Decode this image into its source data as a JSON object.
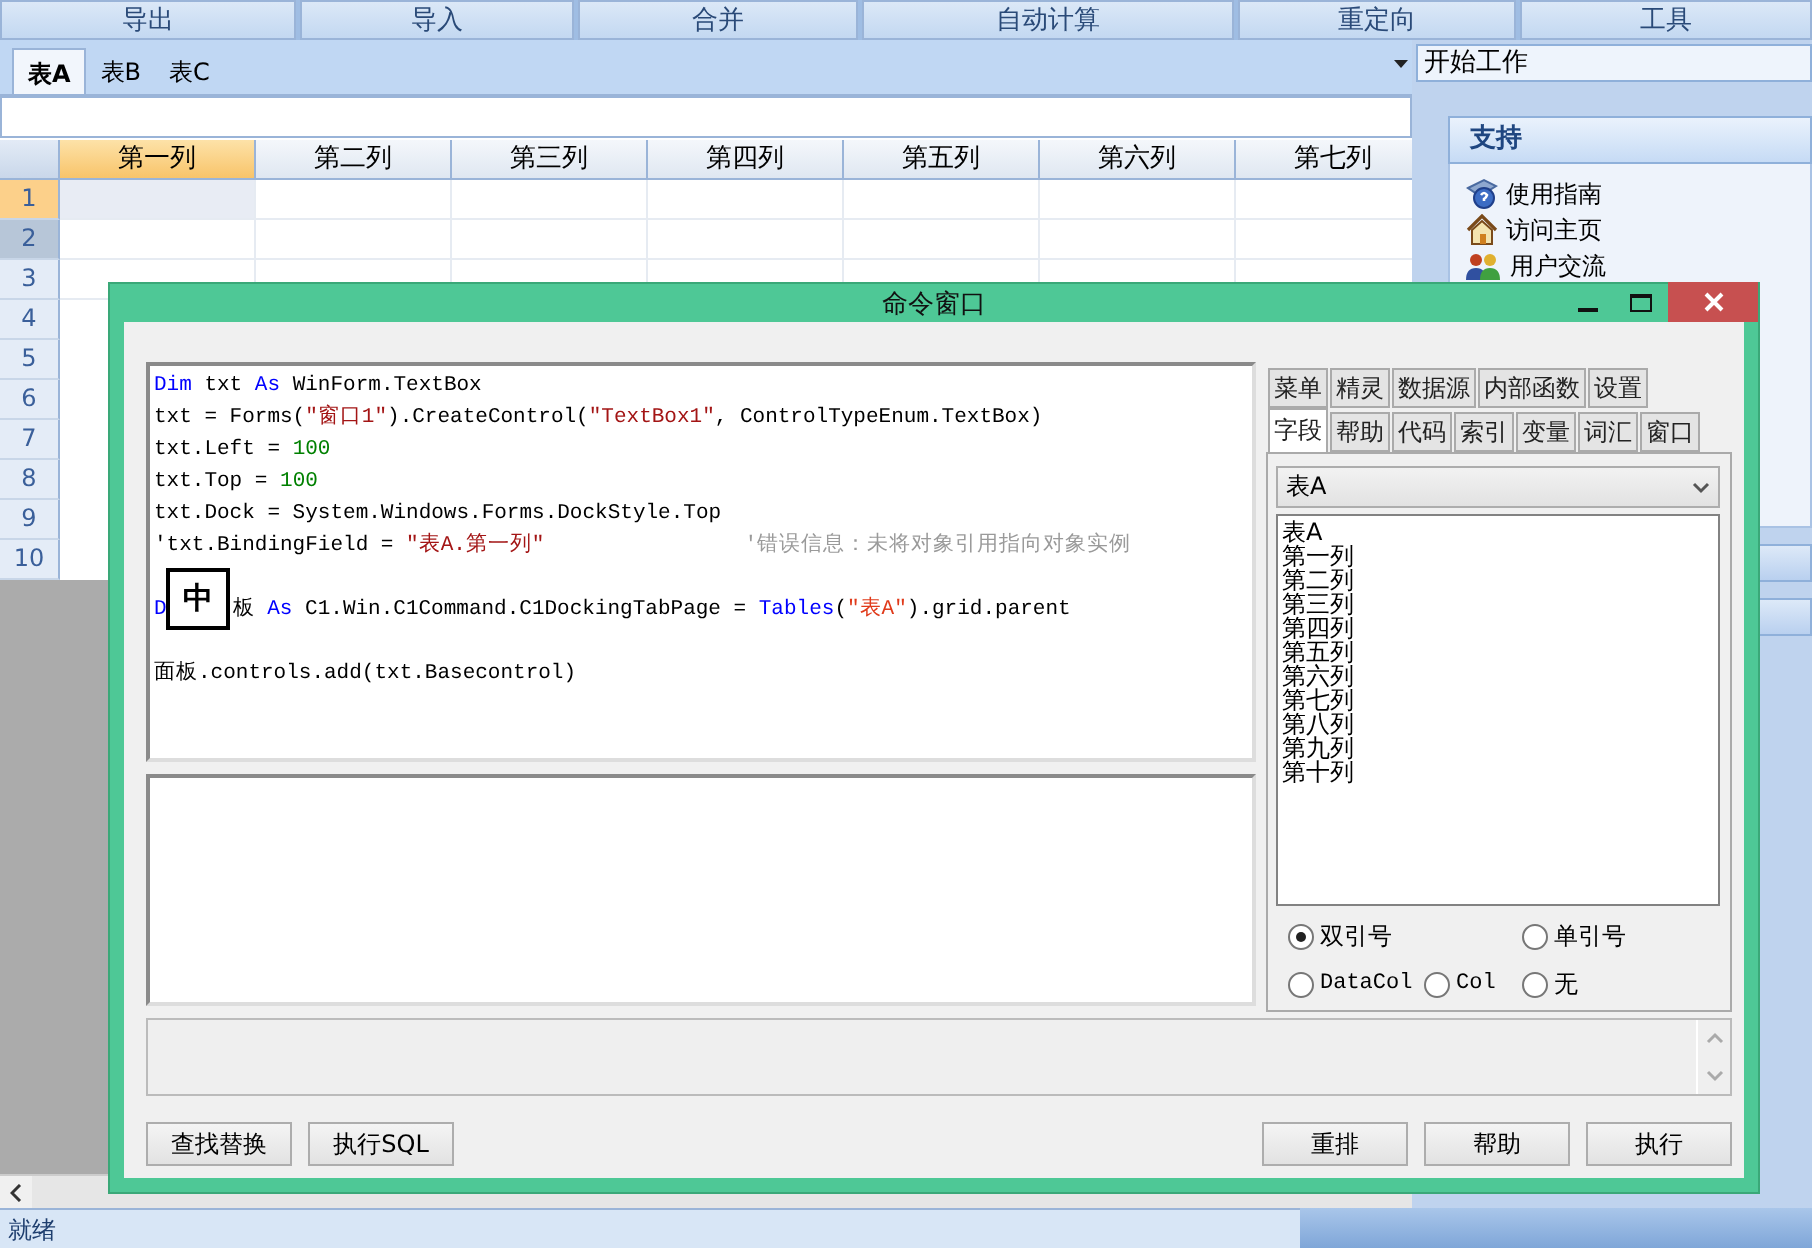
{
  "toolbar": [
    {
      "label": "导出"
    },
    {
      "label": "导入"
    },
    {
      "label": "合并"
    },
    {
      "label": "自动计算"
    },
    {
      "label": "重定向"
    },
    {
      "label": "工具"
    }
  ],
  "sheet_tabs": [
    {
      "label": "表A",
      "selected": true
    },
    {
      "label": "表B",
      "selected": false
    },
    {
      "label": "表C",
      "selected": false
    }
  ],
  "grid": {
    "columns": [
      {
        "label": "第一列",
        "selected": true
      },
      {
        "label": "第二列",
        "selected": false
      },
      {
        "label": "第三列",
        "selected": false
      },
      {
        "label": "第四列",
        "selected": false
      },
      {
        "label": "第五列",
        "selected": false
      },
      {
        "label": "第六列",
        "selected": false
      },
      {
        "label": "第七列",
        "selected": false
      }
    ],
    "rows": [
      {
        "label": "1",
        "selected": true,
        "hover": false
      },
      {
        "label": "2",
        "selected": false,
        "hover": true
      },
      {
        "label": "3",
        "selected": false,
        "hover": false
      },
      {
        "label": "4",
        "selected": false,
        "hover": false
      },
      {
        "label": "5",
        "selected": false,
        "hover": false
      },
      {
        "label": "6",
        "selected": false,
        "hover": false
      },
      {
        "label": "7",
        "selected": false,
        "hover": false
      },
      {
        "label": "8",
        "selected": false,
        "hover": false
      },
      {
        "label": "9",
        "selected": false,
        "hover": false
      },
      {
        "label": "10",
        "selected": false,
        "hover": false
      }
    ]
  },
  "side": {
    "combo": "开始工作",
    "panel": {
      "title": "支持",
      "items": [
        {
          "label": "使用指南"
        },
        {
          "label": "访问主页"
        },
        {
          "label": "用户交流"
        }
      ]
    }
  },
  "status_bar": {
    "text": "就绪"
  },
  "command_window": {
    "title": "命令窗口",
    "code": [
      {
        "kind": "code",
        "tokens": [
          {
            "kind": "keyword",
            "text": "Dim"
          },
          {
            "kind": "plain",
            "text": " txt "
          },
          {
            "kind": "keyword",
            "text": "As"
          },
          {
            "kind": "plain",
            "text": " WinForm.TextBox"
          }
        ]
      },
      {
        "kind": "code",
        "tokens": [
          {
            "kind": "plain",
            "text": "txt = Forms("
          },
          {
            "kind": "string",
            "text": "\"窗口1\""
          },
          {
            "kind": "plain",
            "text": ").CreateControl("
          },
          {
            "kind": "string",
            "text": "\"TextBox1\""
          },
          {
            "kind": "plain",
            "text": ", ControlTypeEnum.TextBox)"
          }
        ]
      },
      {
        "kind": "code",
        "tokens": [
          {
            "kind": "plain",
            "text": "txt.Left = "
          },
          {
            "kind": "number",
            "text": "100"
          }
        ]
      },
      {
        "kind": "code",
        "tokens": [
          {
            "kind": "plain",
            "text": "txt.Top = "
          },
          {
            "kind": "number",
            "text": "100"
          }
        ]
      },
      {
        "kind": "code",
        "tokens": [
          {
            "kind": "plain",
            "text": "txt.Dock = System.Windows.Forms.DockStyle.Top"
          }
        ]
      },
      {
        "kind": "code",
        "tokens": [
          {
            "kind": "plain",
            "text": "'txt.BindingField = "
          },
          {
            "kind": "string",
            "text": "\"表A.第一列\""
          },
          {
            "kind": "comment",
            "text": "'错误信息：未将对象引用指向对象实例"
          }
        ]
      },
      {
        "kind": "blank"
      },
      {
        "kind": "code",
        "tokens": [
          {
            "kind": "keyword",
            "text": "D"
          },
          {
            "kind": "covered",
            "text": "板 "
          },
          {
            "kind": "keyword",
            "text": "As"
          },
          {
            "kind": "plain",
            "text": " C1.Win.C1Command.C1DockingTabPage = "
          },
          {
            "kind": "keyword",
            "text": "Tables"
          },
          {
            "kind": "plain",
            "text": "("
          },
          {
            "kind": "string2",
            "text": "\"表A\""
          },
          {
            "kind": "plain",
            "text": ").grid.parent"
          }
        ]
      },
      {
        "kind": "blank"
      },
      {
        "kind": "code",
        "tokens": [
          {
            "kind": "plain",
            "text": "面板.controls.add(txt.Basecontrol)"
          }
        ]
      }
    ],
    "ime": "中",
    "tabs_row1": [
      {
        "label": "菜单",
        "selected": false
      },
      {
        "label": "精灵",
        "selected": false
      },
      {
        "label": "数据源",
        "selected": false
      },
      {
        "label": "内部函数",
        "selected": false
      },
      {
        "label": "设置",
        "selected": false
      }
    ],
    "tabs_row2": [
      {
        "label": "字段",
        "selected": true
      },
      {
        "label": "帮助",
        "selected": false
      },
      {
        "label": "代码",
        "selected": false
      },
      {
        "label": "索引",
        "selected": false
      },
      {
        "label": "变量",
        "selected": false
      },
      {
        "label": "词汇",
        "selected": false
      },
      {
        "label": "窗口",
        "selected": false
      }
    ],
    "table_select": "表A",
    "fields": [
      "表A",
      "第一列",
      "第二列",
      "第三列",
      "第四列",
      "第五列",
      "第六列",
      "第七列",
      "第八列",
      "第九列",
      "第十列"
    ],
    "quote_rows": [
      {
        "options": [
          {
            "label": "双引号",
            "selected": true
          },
          {
            "label": "单引号",
            "selected": false
          }
        ]
      },
      {
        "options": [
          {
            "label": "DataCol",
            "selected": false
          },
          {
            "label": "Col",
            "selected": false
          },
          {
            "label": "无",
            "selected": false
          }
        ]
      }
    ],
    "buttons_left": [
      "查找替换",
      "执行SQL"
    ],
    "buttons_right": [
      "重排",
      "帮助",
      "执行"
    ]
  }
}
